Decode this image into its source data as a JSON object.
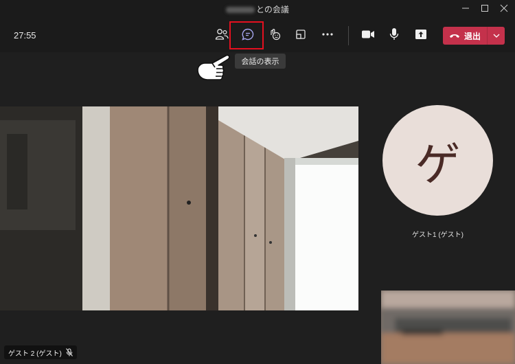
{
  "window": {
    "title": "との会議"
  },
  "toolbar": {
    "timer": "27:55",
    "leave_label": "退出",
    "chat_tooltip": "会話の表示"
  },
  "participants": {
    "guest1": {
      "initial": "ゲ",
      "name": "ゲスト1 (ゲスト)"
    },
    "guest2": {
      "name": "ゲスト 2 (ゲスト)"
    }
  },
  "icons": {
    "participants": "people-icon",
    "chat": "chat-icon",
    "reactions": "reactions-icon",
    "share_tray": "share-tray-icon",
    "more": "more-icon",
    "camera": "camera-icon",
    "microphone": "microphone-icon",
    "share": "share-icon",
    "phone": "phone-icon",
    "muted": "mic-off-icon"
  },
  "colors": {
    "leave": "#c4314b",
    "highlight": "#e5101f",
    "chat_icon": "#a6a7f0",
    "avatar_bg": "#e9ded9",
    "avatar_text": "#4a2a26"
  }
}
